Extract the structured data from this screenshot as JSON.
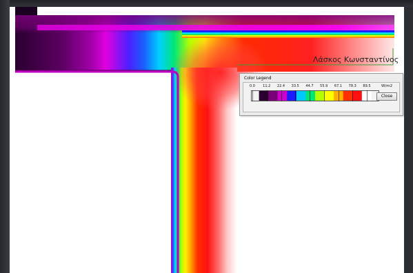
{
  "annotation": {
    "author_name": "Λάσκος Κωνσταντίνος"
  },
  "color_legend": {
    "title": "Color Legend",
    "tick_labels": [
      "0.0",
      "11.2",
      "22.4",
      "33.5",
      "44.7",
      "55.9",
      "67.1",
      "78.3",
      "89.5"
    ],
    "unit": "W/m2",
    "close_label": "Close",
    "palette": [
      "#2a0030",
      "#7a0078",
      "#cc00cc",
      "#1a1aff",
      "#00c8ff",
      "#00e676",
      "#b4ff00",
      "#ffff00",
      "#ffb000",
      "#ff3000",
      "#ff1010",
      "#ffffff"
    ]
  },
  "colors": {
    "background": "#ffffff",
    "frame": "#2b2e33"
  }
}
